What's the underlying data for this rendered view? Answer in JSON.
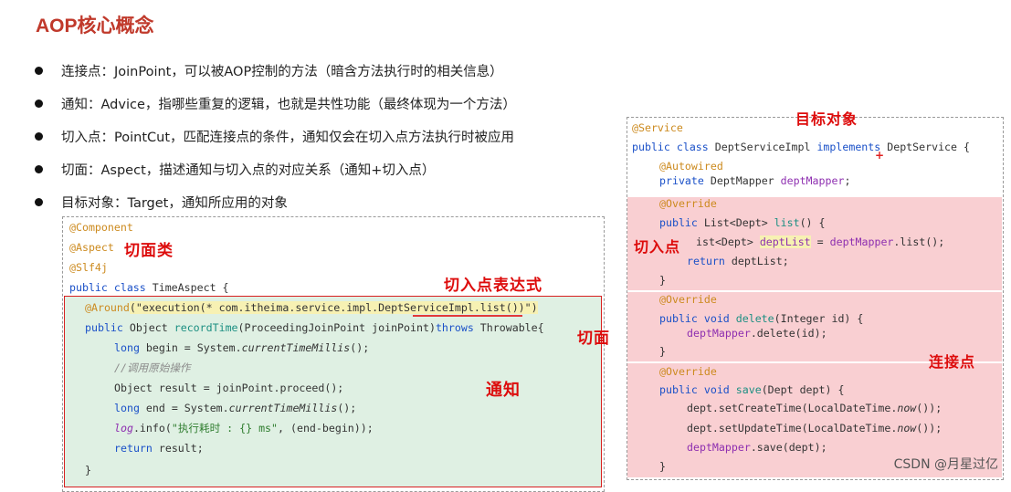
{
  "title": "AOP核心概念",
  "bullets": [
    "连接点：JoinPoint，可以被AOP控制的方法（暗含方法执行时的相关信息）",
    "通知：Advice，指哪些重复的逻辑，也就是共性功能（最终体现为一个方法）",
    "切入点：PointCut，匹配连接点的条件，通知仅会在切入点方法执行时被应用",
    "切面：Aspect，描述通知与切入点的对应关系（通知+切入点）",
    "目标对象：Target，通知所应用的对象"
  ],
  "left_code": {
    "l1": "@Component",
    "l2": "@Aspect",
    "l3": "@Slf4j",
    "l4_kw": "public class",
    "l4_rest": " TimeAspect {",
    "l5_ann": "@Around",
    "l5_p1": "(\"execution(* com.itheima.service.impl.",
    "l5_p2": "DeptServiceImpl",
    "l5_p3": ".list())\")",
    "l6_kw": "public",
    "l6_a": " Object ",
    "l6_fn": "recordTime",
    "l6_b": "(ProceedingJoinPoint joinPoint)",
    "l6_kw2": "throws",
    "l6_c": " Throwable{",
    "l7_kw": "long",
    "l7_a": " begin = System.",
    "l7_st": "currentTimeMillis",
    "l7_b": "();",
    "l8": "//调用原始操作",
    "l9": "Object result = joinPoint.proceed();",
    "l10_kw": "long",
    "l10_a": " end = System.",
    "l10_st": "currentTimeMillis",
    "l10_b": "();",
    "l11_st": "log",
    "l11_a": ".info(",
    "l11_str": "\"执行耗时 : {} ms\"",
    "l11_b": ", (end-begin));",
    "l12_kw": "return",
    "l12_a": " result;",
    "l13": "}"
  },
  "right_code": {
    "r1": "@Service",
    "r2_kw": "public class",
    "r2_a": " DeptServiceImpl ",
    "r2_kw2": "implements",
    "r2_b": " DeptService {",
    "r3": "@Autowired",
    "r4_kw": "private",
    "r4_a": " DeptMapper ",
    "r4_fld": "deptMapper",
    "r4_b": ";",
    "r5": "@Override",
    "r6_kw": "public",
    "r6_a": " List<Dept> ",
    "r6_fn": "list",
    "r6_b": "() {",
    "r7_a": "ist<Dept> ",
    "r7_hl": "deptList",
    "r7_b": " = ",
    "r7_fld": "deptMapper",
    "r7_c": ".list();",
    "r8_kw": "return",
    "r8_a": " deptList;",
    "r9": "}",
    "r10": "@Override",
    "r11_kw": "public void",
    "r11_fn": " delete",
    "r11_a": "(Integer id) {",
    "r12_fld": "deptMapper",
    "r12_a": ".delete(id);",
    "r13": "}",
    "r14": "@Override",
    "r15_kw": "public void",
    "r15_fn": " save",
    "r15_a": "(Dept dept) {",
    "r16_a": "dept.setCreateTime(LocalDateTime.",
    "r16_st": "now",
    "r16_b": "());",
    "r17_a": "dept.setUpdateTime(LocalDateTime.",
    "r17_st": "now",
    "r17_b": "());",
    "r18_fld": "deptMapper",
    "r18_a": ".save(dept);",
    "r19": "}"
  },
  "handwritten": {
    "aspect_class": "切面类",
    "pointcut_expr": "切入点表达式",
    "aspect": "切面",
    "advice": "通知",
    "target": "目标对象",
    "pointcut": "切入点",
    "joinpoint": "连接点"
  },
  "watermark": "CSDN @月星过亿",
  "colors": {
    "title": "#c0392b",
    "handwriting": "#dd0c0c",
    "advice_box": "#dff0e3",
    "joinpoint_box": "#f9cfd2"
  }
}
